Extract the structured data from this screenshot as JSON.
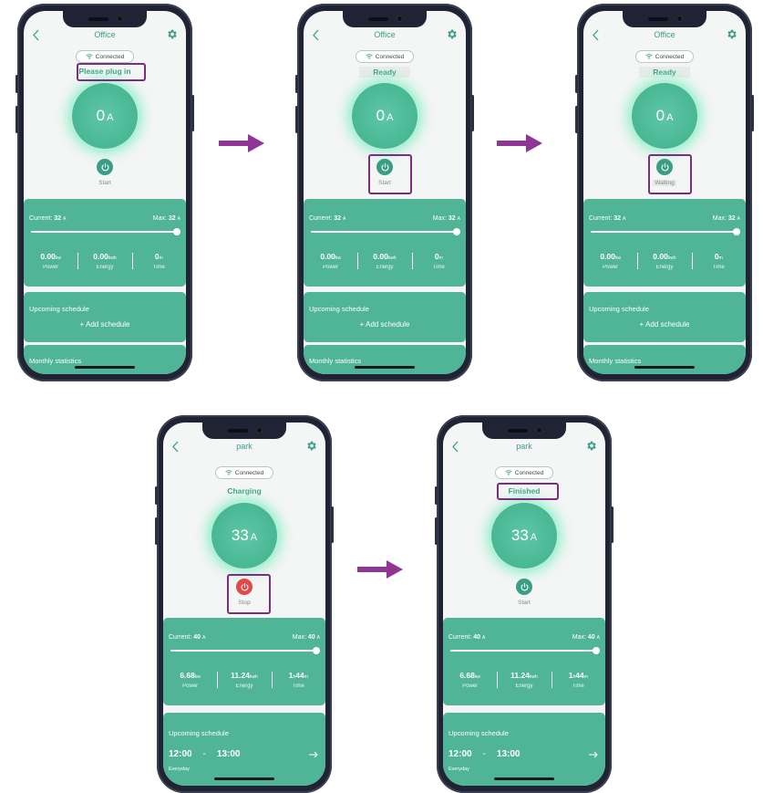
{
  "phones": [
    {
      "title": "Office",
      "connection": "Connected",
      "status": "Please plug in",
      "amps": "0",
      "amp_unit": "A",
      "button": "Start",
      "current_label": "Current:",
      "current": "32",
      "current_unit": "A",
      "max_label": "Max:",
      "max": "32",
      "max_unit": "A",
      "power": "0.00",
      "power_unit": "kw",
      "power_label": "Power",
      "energy": "0.00",
      "energy_unit": "kwh",
      "energy_label": "Energy",
      "time": "0",
      "time_unit": "m",
      "time_label": "Time",
      "schedule_heading": "Upcoming schedule",
      "add_schedule": "+ Add schedule",
      "monthly": "Monthly statistics"
    },
    {
      "title": "Office",
      "connection": "Connected",
      "status": "Ready",
      "amps": "0",
      "amp_unit": "A",
      "button": "Start",
      "current_label": "Current:",
      "current": "32",
      "current_unit": "A",
      "max_label": "Max:",
      "max": "32",
      "max_unit": "A",
      "power": "0.00",
      "power_unit": "kw",
      "power_label": "Power",
      "energy": "0.00",
      "energy_unit": "kwh",
      "energy_label": "Energy",
      "time": "0",
      "time_unit": "m",
      "time_label": "Time",
      "schedule_heading": "Upcoming schedule",
      "add_schedule": "+ Add schedule",
      "monthly": "Monthly statistics"
    },
    {
      "title": "Office",
      "connection": "Connected",
      "status": "Ready",
      "amps": "0",
      "amp_unit": "A",
      "button": "Waiting",
      "current_label": "Current:",
      "current": "32",
      "current_unit": "A",
      "max_label": "Max:",
      "max": "32",
      "max_unit": "A",
      "power": "0.00",
      "power_unit": "kw",
      "power_label": "Power",
      "energy": "0.00",
      "energy_unit": "kwh",
      "energy_label": "Energy",
      "time": "0",
      "time_unit": "m",
      "time_label": "Time",
      "schedule_heading": "Upcoming schedule",
      "add_schedule": "+ Add schedule",
      "monthly": "Monthly statistics"
    },
    {
      "title": "park",
      "connection": "Connected",
      "status": "Charging",
      "amps": "33",
      "amp_unit": "A",
      "button": "Stop",
      "current_label": "Current:",
      "current": "40",
      "current_unit": "A",
      "max_label": "Max:",
      "max": "40",
      "max_unit": "A",
      "power": "6.68",
      "power_unit": "kw",
      "power_label": "Power",
      "energy": "11.24",
      "energy_unit": "kwh",
      "energy_label": "Energy",
      "time_h": "1",
      "time_h_unit": "h",
      "time": "44",
      "time_unit": "m",
      "time_label": "Time",
      "schedule_heading": "Upcoming schedule",
      "schedule_start": "12:00",
      "schedule_sep": "-",
      "schedule_end": "13:00",
      "schedule_repeat": "Everyday"
    },
    {
      "title": "park",
      "connection": "Connected",
      "status": "Finished",
      "amps": "33",
      "amp_unit": "A",
      "button": "Start",
      "current_label": "Current:",
      "current": "40",
      "current_unit": "A",
      "max_label": "Max:",
      "max": "40",
      "max_unit": "A",
      "power": "6.68",
      "power_unit": "kw",
      "power_label": "Power",
      "energy": "11.24",
      "energy_unit": "kwh",
      "energy_label": "Energy",
      "time_h": "1",
      "time_h_unit": "h",
      "time": "44",
      "time_unit": "m",
      "time_label": "Time",
      "schedule_heading": "Upcoming schedule",
      "schedule_start": "12:00",
      "schedule_sep": "-",
      "schedule_end": "13:00",
      "schedule_repeat": "Everyday"
    }
  ],
  "colors": {
    "accent": "#3a9e86",
    "card": "#4fb596",
    "highlight": "#7b2d7f",
    "stop": "#e04b48",
    "arrow": "#8e3596"
  }
}
